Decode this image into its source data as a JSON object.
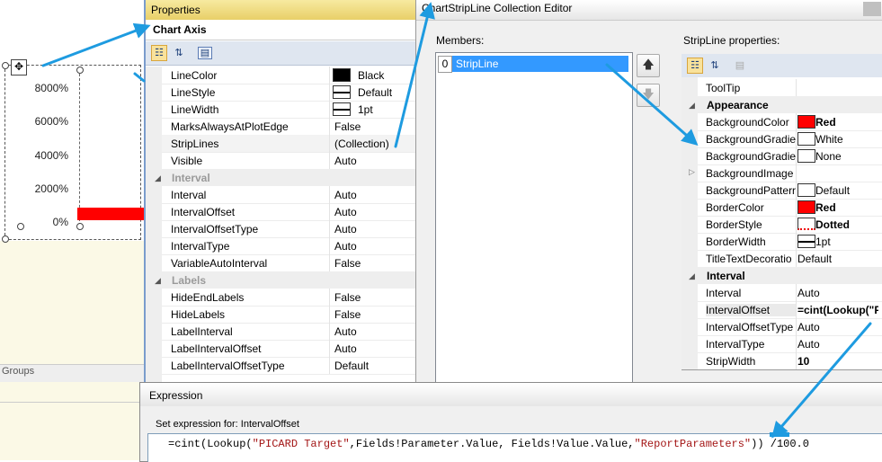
{
  "designer": {
    "y_ticks": [
      "8000%",
      "6000%",
      "4000%",
      "2000%",
      "0%"
    ],
    "groups_label": "Groups"
  },
  "properties": {
    "title": "Properties",
    "object": "Chart Axis",
    "rows": [
      {
        "kind": "prop",
        "name": "LineColor",
        "value": "Black",
        "swatch": "#000000"
      },
      {
        "kind": "prop",
        "name": "LineStyle",
        "value": "Default",
        "swatch": "line"
      },
      {
        "kind": "prop",
        "name": "LineWidth",
        "value": "1pt",
        "swatch": "line"
      },
      {
        "kind": "prop",
        "name": "MarksAlwaysAtPlotEdge",
        "value": "False"
      },
      {
        "kind": "prop",
        "name": "StripLines",
        "value": "(Collection)",
        "selected": true
      },
      {
        "kind": "prop",
        "name": "Visible",
        "value": "Auto"
      },
      {
        "kind": "cat",
        "name": "Interval"
      },
      {
        "kind": "prop",
        "name": "Interval",
        "value": "Auto"
      },
      {
        "kind": "prop",
        "name": "IntervalOffset",
        "value": "Auto"
      },
      {
        "kind": "prop",
        "name": "IntervalOffsetType",
        "value": "Auto"
      },
      {
        "kind": "prop",
        "name": "IntervalType",
        "value": "Auto"
      },
      {
        "kind": "prop",
        "name": "VariableAutoInterval",
        "value": "False"
      },
      {
        "kind": "cat",
        "name": "Labels"
      },
      {
        "kind": "prop",
        "name": "HideEndLabels",
        "value": "False"
      },
      {
        "kind": "prop",
        "name": "HideLabels",
        "value": "False"
      },
      {
        "kind": "prop",
        "name": "LabelInterval",
        "value": "Auto"
      },
      {
        "kind": "prop",
        "name": "LabelIntervalOffset",
        "value": "Auto"
      },
      {
        "kind": "prop",
        "name": "LabelIntervalOffsetType",
        "value": "Default"
      }
    ]
  },
  "editor": {
    "title": "ChartStripLine Collection Editor",
    "members_label": "Members:",
    "member_index": "0",
    "member_name": "StripLine",
    "properties_label": "StripLine properties:",
    "rows": [
      {
        "kind": "prop",
        "name": "ToolTip",
        "value": ""
      },
      {
        "kind": "cat",
        "name": "Appearance"
      },
      {
        "kind": "prop",
        "name": "BackgroundColor",
        "value": "Red",
        "swatch": "#ff0000",
        "bold": true
      },
      {
        "kind": "prop",
        "name": "BackgroundGradie",
        "value": "White",
        "swatch": "#ffffff"
      },
      {
        "kind": "prop",
        "name": "BackgroundGradie",
        "value": "None",
        "swatch": "#ffffff"
      },
      {
        "kind": "prop",
        "name": "BackgroundImage",
        "value": "",
        "expand": true
      },
      {
        "kind": "prop",
        "name": "BackgroundPatterr",
        "value": "Default",
        "swatch": "#ffffff"
      },
      {
        "kind": "prop",
        "name": "BorderColor",
        "value": "Red",
        "swatch": "#ff0000",
        "bold": true
      },
      {
        "kind": "prop",
        "name": "BorderStyle",
        "value": "Dotted",
        "swatch": "dotted",
        "bold": true
      },
      {
        "kind": "prop",
        "name": "BorderWidth",
        "value": "1pt",
        "swatch": "line"
      },
      {
        "kind": "prop",
        "name": "TitleTextDecoratio",
        "value": "Default"
      },
      {
        "kind": "cat",
        "name": "Interval"
      },
      {
        "kind": "prop",
        "name": "Interval",
        "value": "Auto"
      },
      {
        "kind": "prop",
        "name": "IntervalOffset",
        "value": "=cint(Lookup(\"PI",
        "bold": true,
        "selected": true
      },
      {
        "kind": "prop",
        "name": "IntervalOffsetType",
        "value": "Auto"
      },
      {
        "kind": "prop",
        "name": "IntervalType",
        "value": "Auto"
      },
      {
        "kind": "prop",
        "name": "StripWidth",
        "value": "10",
        "bold": true
      }
    ]
  },
  "expression": {
    "title": "Expression",
    "caption": "Set expression for: IntervalOffset",
    "code_parts": [
      {
        "t": "=cint(Lookup(",
        "c": "kw"
      },
      {
        "t": "\"PICARD Target\"",
        "c": "str"
      },
      {
        "t": ",Fields!Parameter.Value, Fields!Value.Value,",
        "c": "kw"
      },
      {
        "t": "\"ReportParameters\"",
        "c": "str"
      },
      {
        "t": ")) /100.0",
        "c": "kw"
      }
    ]
  },
  "colors": {
    "accent_arrow": "#1e9be0",
    "selection": "#3399ff",
    "strip_red": "#ff0000"
  }
}
